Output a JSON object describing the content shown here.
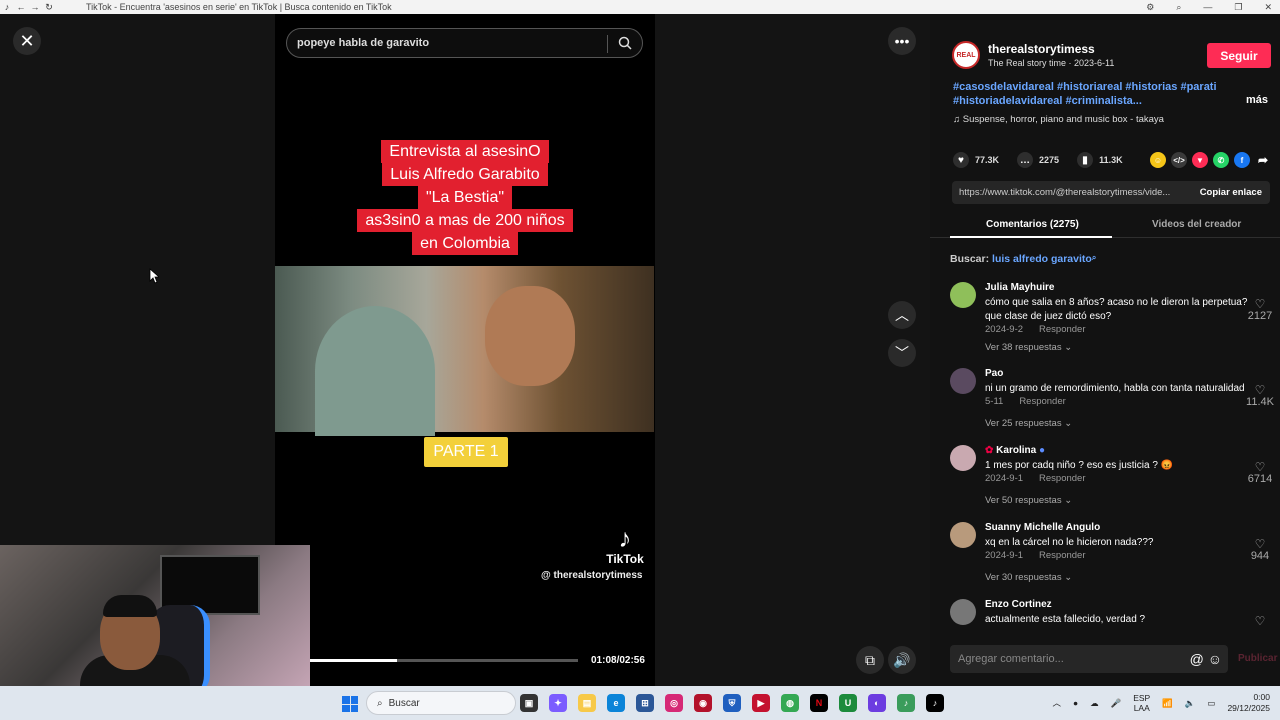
{
  "browser": {
    "title": "TikTok - Encuentra 'asesinos en serie' en TikTok | Busca contenido en TikTok"
  },
  "player": {
    "search_value": "popeye habla de garavito",
    "caption_lines": [
      "Entrevista al asesinO",
      "Luis Alfredo Garabito",
      "\"La Bestia\"",
      "as3sin0 a mas de 200 niños",
      "en Colombia"
    ],
    "parte_label": "PARTE 1",
    "watermark": "TikTok",
    "handle": "@ therealstorytimess",
    "timecode": "01:08/02:56",
    "progress_fraction": 0.325
  },
  "post": {
    "creator_handle": "therealstorytimess",
    "creator_subtitle": "The Real story time · 2023-6-11",
    "avatar_text": "REAL",
    "follow_label": "Seguir",
    "hashtags_line1": "#casosdelavidareal #historiareal #historias #parati",
    "hashtags_line2": "#historiadelavidareal #criminalista...",
    "more_label": "más",
    "music": "Suspense, horror, piano and music box - takaya",
    "likes": "77.3K",
    "comments": "2275",
    "saves": "11.3K",
    "link": "https://www.tiktok.com/@therealstorytimess/vide...",
    "copy_link_label": "Copiar enlace",
    "tab_comments": "Comentarios (2275)",
    "tab_creator": "Videos del creador",
    "search_prefix": "Buscar:",
    "search_query": "luis alfredo garavito"
  },
  "comments": [
    {
      "name": "Julia Mayhuire",
      "text": "cómo que salia en 8 años? acaso no le dieron la perpetua? que clase de juez dictó eso?",
      "date": "2024-9-2",
      "reply": "Responder",
      "replies": "Ver 38 respuestas",
      "likes": "2127"
    },
    {
      "name": "Pao",
      "text": "ni un gramo de remordimiento, habla con tanta naturalidad",
      "date": "5-11",
      "reply": "Responder",
      "replies": "Ver 25 respuestas",
      "likes": "11.4K"
    },
    {
      "name": "Karolina",
      "text": "1 mes por cadq niño ? eso es justicia ? 😡",
      "date": "2024-9-1",
      "reply": "Responder",
      "replies": "Ver 50 respuestas",
      "likes": "6714"
    },
    {
      "name": "Suanny Michelle Angulo",
      "text": "xq en la cárcel no le hicieron nada???",
      "date": "2024-9-1",
      "reply": "Responder",
      "replies": "Ver 30 respuestas",
      "likes": "944"
    },
    {
      "name": "Enzo Cortinez",
      "text": "actualmente esta fallecido, verdad ?",
      "date": "",
      "reply": "",
      "replies": "",
      "likes": ""
    }
  ],
  "comment_input": {
    "placeholder": "Agregar comentario...",
    "publish_label": "Publicar"
  },
  "taskbar": {
    "search_placeholder": "Buscar",
    "lang_top": "ESP",
    "lang_bottom": "LAA",
    "time": "0:00",
    "date": "29/12/2025"
  }
}
